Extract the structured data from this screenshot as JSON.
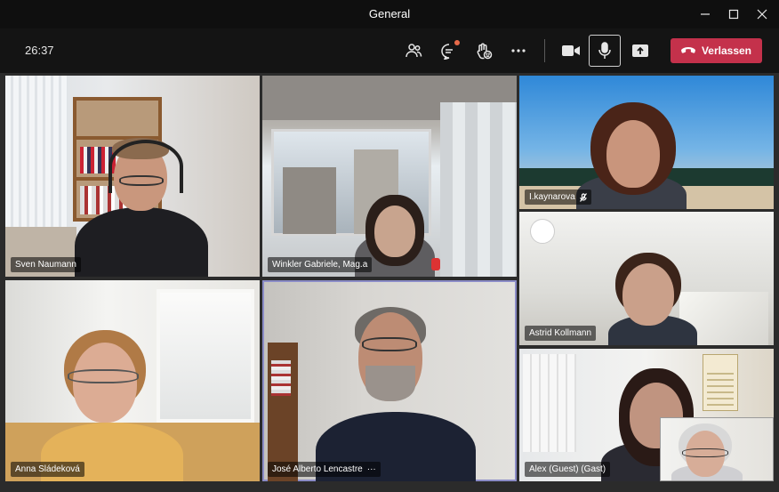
{
  "window": {
    "title": "General"
  },
  "toolbar": {
    "timer": "26:37",
    "icons": [
      "participants-icon",
      "chat-icon",
      "reactions-icon",
      "more-icon",
      "camera-icon",
      "microphone-icon",
      "share-icon",
      "hangup-icon"
    ],
    "leave_label": "Verlassen",
    "leave_color": "#c4314b"
  },
  "participants": [
    {
      "name": "Sven Naumann"
    },
    {
      "name": "Winkler Gabriele, Mag.a"
    },
    {
      "name": "I.kaynarova",
      "muted": true
    },
    {
      "name": "Astrid Kollmann"
    },
    {
      "name": "Anna Sládeková"
    },
    {
      "name": "José Alberto Lencastre",
      "speaking": true,
      "more_label": "···"
    },
    {
      "name": "Alex (Guest) (Gast)"
    }
  ],
  "colors": {
    "speaking_outline": "#8b8cc7",
    "background": "#1f1f1f"
  }
}
